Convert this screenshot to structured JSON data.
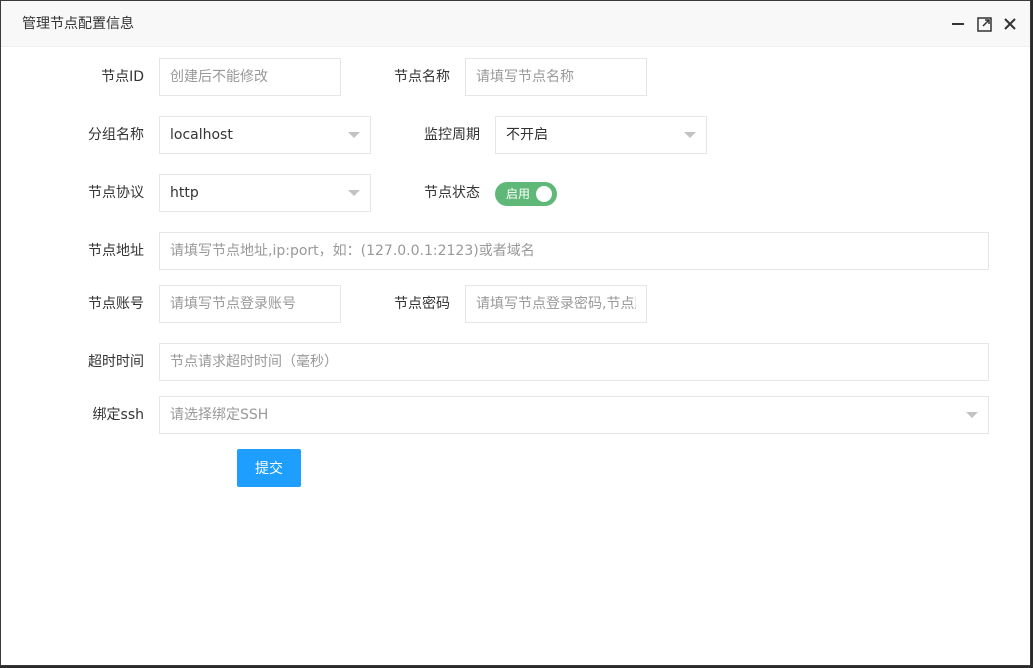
{
  "window": {
    "title": "管理节点配置信息"
  },
  "form": {
    "node_id": {
      "label": "节点ID",
      "placeholder": "创建后不能修改"
    },
    "node_name": {
      "label": "节点名称",
      "placeholder": "请填写节点名称"
    },
    "group": {
      "label": "分组名称",
      "value": "localhost"
    },
    "monitor": {
      "label": "监控周期",
      "value": "不开启"
    },
    "protocol": {
      "label": "节点协议",
      "value": "http"
    },
    "status": {
      "label": "节点状态",
      "switch_text": "启用",
      "on": true
    },
    "address": {
      "label": "节点地址",
      "placeholder": "请填写节点地址,ip:port，如：(127.0.0.1:2123)或者域名"
    },
    "account": {
      "label": "节点账号",
      "placeholder": "请填写节点登录账号"
    },
    "password": {
      "label": "节点密码",
      "placeholder": "请填写节点登录密码,节点默"
    },
    "timeout": {
      "label": "超时时间",
      "placeholder": "节点请求超时时间（毫秒）"
    },
    "ssh": {
      "label": "绑定ssh",
      "placeholder": "请选择绑定SSH"
    },
    "submit_label": "提交"
  },
  "colors": {
    "switch_on": "#5fb878",
    "primary_button": "#1e9fff"
  }
}
